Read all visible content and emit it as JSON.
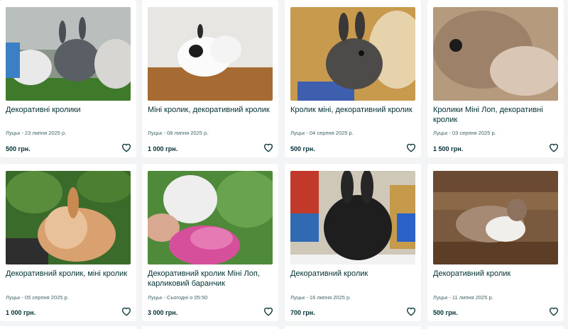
{
  "listings": [
    {
      "title": "Декоративні кролики",
      "location": "Луцьк",
      "date": "23 липня 2025 р.",
      "price": "500 грн."
    },
    {
      "title": "Міні кролик, декоративний кролик",
      "location": "Луцьк",
      "date": "08 липня 2025 р.",
      "price": "1 000 грн."
    },
    {
      "title": "Кролик міні, декоративний кролик",
      "location": "Луцьк",
      "date": "04 серпня 2025 р.",
      "price": "500 грн."
    },
    {
      "title": "Кролики Міні Лоп, декоративні кролик",
      "location": "Луцьк",
      "date": "03 серпня 2025 р.",
      "price": "1 500 грн."
    },
    {
      "title": "Декоративний кролик, міні кролик",
      "location": "Луцьк",
      "date": "05 серпня 2025 р.",
      "price": "1 000 грн."
    },
    {
      "title": "Декоративний кролик Міні Лоп, карликовий баранчик",
      "location": "Луцьк",
      "date": "Сьогодні о 05:50",
      "price": "3 000 грн."
    },
    {
      "title": "Декоративний кролик",
      "location": "Луцьк",
      "date": "16 липня 2025 р.",
      "price": "700 грн."
    },
    {
      "title": "Декоративний кролик",
      "location": "Луцьк",
      "date": "11 липня 2025 р.",
      "price": "500 грн."
    }
  ],
  "icons": {
    "favorite": "heart-outline-icon"
  }
}
